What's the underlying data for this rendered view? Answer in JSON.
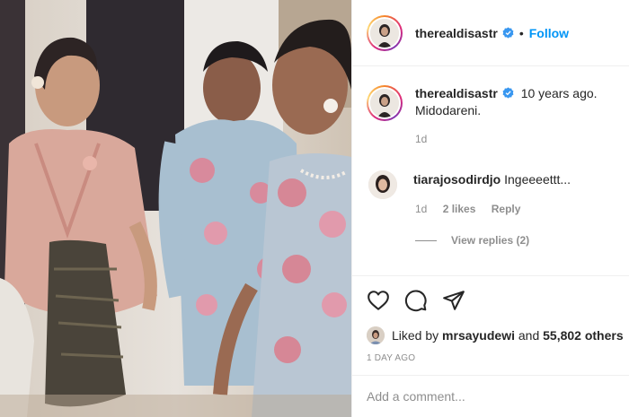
{
  "post": {
    "username": "therealdisastr",
    "follow_label": "Follow",
    "dot": "•"
  },
  "caption": {
    "username": "therealdisastr",
    "time": "10 years ago.",
    "text": "Midodareni.",
    "age": "1d"
  },
  "comment": {
    "username": "tiarajosodirdjo",
    "text": "Ingeeeettt...",
    "age": "1d",
    "likes": "2 likes",
    "reply": "Reply"
  },
  "view_replies": "View replies (2)",
  "likes_line": {
    "prefix": "Liked by",
    "user": "mrsayudewi",
    "middle": "and",
    "count": "55,802 others"
  },
  "posted": "1 DAY AGO",
  "add_comment_placeholder": "Add a comment...",
  "colors": {
    "accent": "#0095f6",
    "muted": "#8e8e8e",
    "border": "#efefef",
    "text": "#262626"
  },
  "icons": [
    "heart-icon",
    "comment-icon",
    "share-icon",
    "verified-badge-icon"
  ]
}
